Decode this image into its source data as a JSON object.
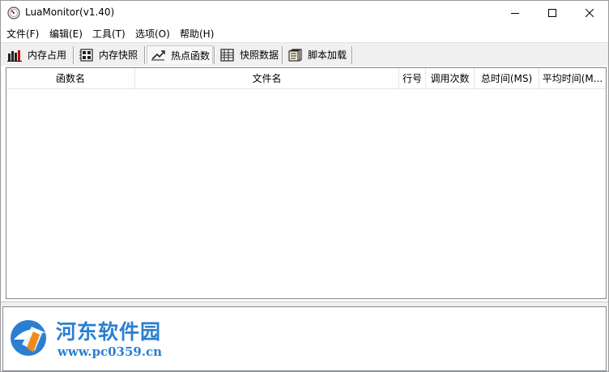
{
  "window": {
    "title": "LuaMonitor(v1.40)"
  },
  "menu": [
    {
      "label": "文件(F)"
    },
    {
      "label": "编辑(E)"
    },
    {
      "label": "工具(T)"
    },
    {
      "label": "选项(O)"
    },
    {
      "label": "帮助(H)"
    }
  ],
  "tabs": [
    {
      "label": "内存占用",
      "icon": "bar-chart-icon"
    },
    {
      "label": "内存快照",
      "icon": "memory-chip-icon"
    },
    {
      "label": "热点函数",
      "icon": "hot-function-icon",
      "selected": true
    },
    {
      "label": "快照数据",
      "icon": "spreadsheet-icon"
    },
    {
      "label": "脚本加载",
      "icon": "script-pages-icon"
    }
  ],
  "table": {
    "columns": [
      "函数名",
      "文件名",
      "行号",
      "调用次数",
      "总时间(MS)",
      "平均时间(M..."
    ],
    "rows": []
  },
  "watermark": {
    "name": "河东软件园",
    "url": "www.pc0359.cn"
  },
  "colors": {
    "watermark_blue": "#2a7fd2",
    "watermark_orange": "#f08a1a"
  }
}
